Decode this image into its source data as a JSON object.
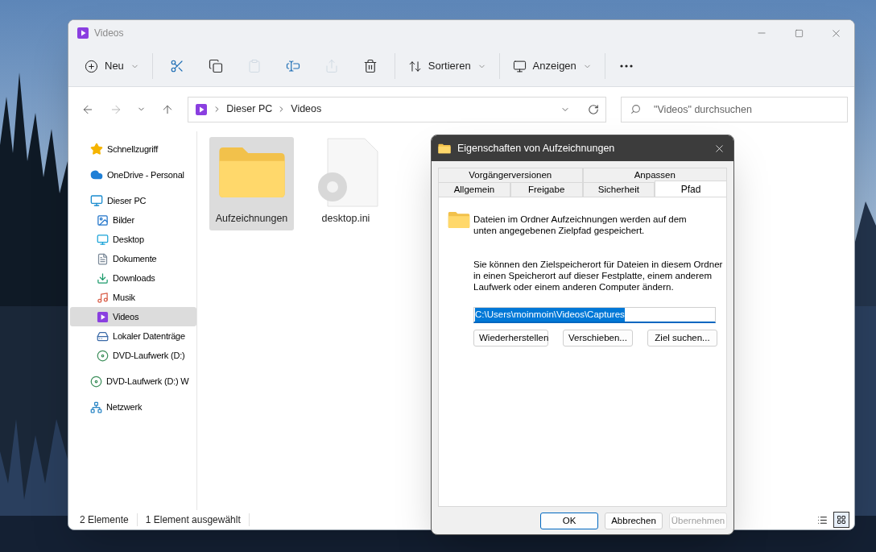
{
  "window": {
    "title": "Videos"
  },
  "toolbar": {
    "groups": [
      [
        {
          "label": "Neu",
          "disabled": false
        }
      ],
      [
        {
          "disabled": false
        },
        {
          "disabled": false
        },
        {
          "disabled": true
        },
        {
          "disabled": false
        },
        {
          "disabled": true
        },
        {
          "disabled": false
        }
      ],
      [
        {
          "label": "Sortieren",
          "disabled": false
        }
      ],
      [
        {
          "label": "Anzeigen",
          "disabled": false
        }
      ],
      [
        {
          "disabled": false
        }
      ]
    ]
  },
  "navigation": {
    "back_disabled": false,
    "forward_disabled": true
  },
  "address": {
    "breadcrumb": [
      "Dieser PC",
      "Videos"
    ]
  },
  "search": {
    "placeholder": "\"Videos\" durchsuchen"
  },
  "sidebar": {
    "items": [
      {
        "label": "Schnellzugriff",
        "kind": "star",
        "selected": false
      },
      {
        "label": "OneDrive - Personal",
        "kind": "cloud",
        "selected": false
      },
      {
        "label": "Dieser PC",
        "kind": "pc",
        "selected": false,
        "children": [
          {
            "label": "Bilder",
            "kind": "pictures",
            "selected": false
          },
          {
            "label": "Desktop",
            "kind": "desktop",
            "selected": false
          },
          {
            "label": "Dokumente",
            "kind": "documents",
            "selected": false
          },
          {
            "label": "Downloads",
            "kind": "downloads",
            "selected": false
          },
          {
            "label": "Musik",
            "kind": "music",
            "selected": false
          },
          {
            "label": "Videos",
            "kind": "videos",
            "selected": true
          },
          {
            "label": "Lokaler Datenträge",
            "kind": "drive",
            "selected": false
          },
          {
            "label": "DVD-Laufwerk (D:)",
            "kind": "dvd",
            "selected": false
          }
        ]
      },
      {
        "label": "DVD-Laufwerk (D:) W",
        "kind": "dvd",
        "selected": false
      },
      {
        "label": "Netzwerk",
        "kind": "network",
        "selected": false
      }
    ]
  },
  "files": [
    {
      "name": "Aufzeichnungen",
      "kind": "folder",
      "selected": true
    },
    {
      "name": "desktop.ini",
      "kind": "settings-file",
      "selected": false
    }
  ],
  "status_bar": {
    "texts": [
      "2 Elemente",
      "1 Element ausgewählt"
    ],
    "views": [
      {
        "selected": false
      },
      {
        "selected": true
      }
    ]
  },
  "dialog": {
    "title": "Eigenschaften von Aufzeichnungen",
    "tab_rows": [
      [
        {
          "label": "Vorgängerversionen",
          "selected": false
        },
        {
          "label": "Anpassen",
          "selected": false
        }
      ],
      [
        {
          "label": "Allgemein",
          "selected": false
        },
        {
          "label": "Freigabe",
          "selected": false
        },
        {
          "label": "Sicherheit",
          "selected": false
        },
        {
          "label": "Pfad",
          "selected": true
        }
      ]
    ],
    "intro": "Dateien im Ordner Aufzeichnungen werden auf dem unten angegebenen Zielpfad gespeichert.",
    "description": "Sie können den Zielspeicherort für Dateien in diesem Ordner in einen Speicherort auf dieser Festplatte, einem anderem Laufwerk oder einem anderen Computer ändern.",
    "path_field": {
      "value": "C:\\Users\\moinmoin\\Videos\\Captures",
      "selected": true
    },
    "buttons": [
      "Wiederherstellen",
      "Verschieben...",
      "Ziel suchen..."
    ],
    "footer_buttons": [
      {
        "label": "OK",
        "default": true,
        "disabled": false
      },
      {
        "label": "Abbrechen",
        "default": false,
        "disabled": false
      },
      {
        "label": "Übernehmen",
        "default": false,
        "disabled": true
      }
    ]
  }
}
